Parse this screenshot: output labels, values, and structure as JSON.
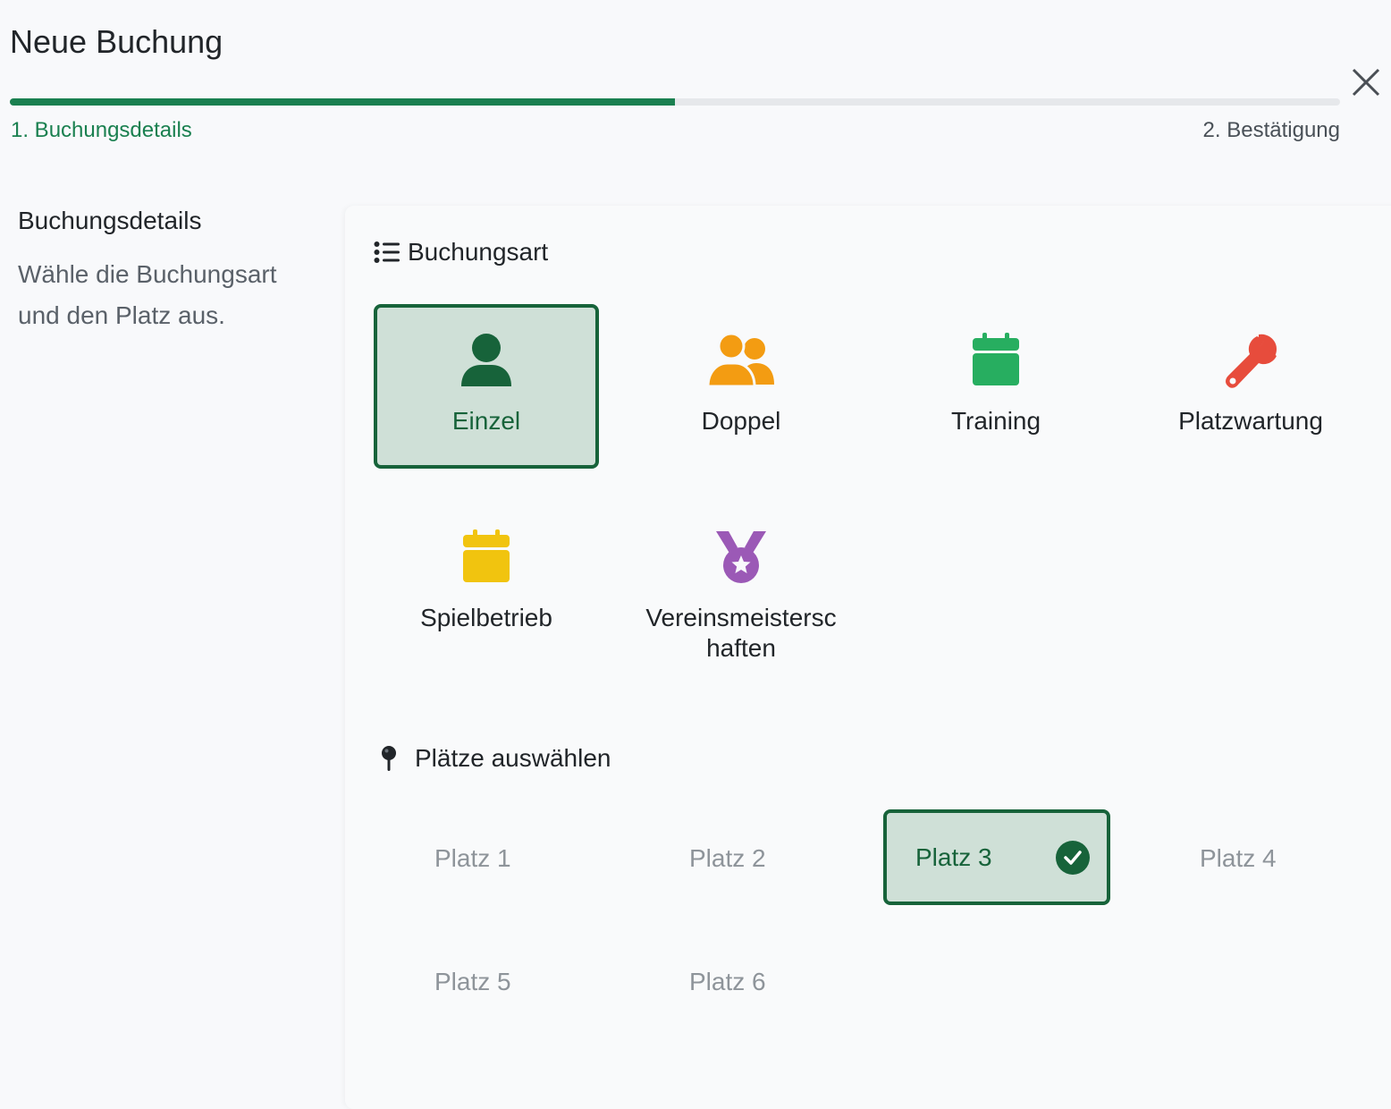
{
  "dialog": {
    "title": "Neue Buchung"
  },
  "progress": {
    "fraction": 0.5,
    "color": "#1a8050"
  },
  "steps": [
    {
      "label": "1. Buchungsdetails",
      "active": true
    },
    {
      "label": "2. Bestätigung",
      "active": false
    }
  ],
  "sidebar": {
    "title": "Buchungsdetails",
    "description": "Wähle die Buchungsart und den Platz aus."
  },
  "booking_type": {
    "heading": "Buchungsart",
    "heading_icon": "list-icon",
    "options": [
      {
        "label": "Einzel",
        "icon": "user-icon",
        "color": "#17633a",
        "selected": true
      },
      {
        "label": "Doppel",
        "icon": "users-icon",
        "color": "#f39c12",
        "selected": false
      },
      {
        "label": "Training",
        "icon": "calendar-icon",
        "color": "#27ae60",
        "selected": false
      },
      {
        "label": "Platzwartung",
        "icon": "wrench-icon",
        "color": "#e74c3c",
        "selected": false
      },
      {
        "label": "Spielbetrieb",
        "icon": "calendar-icon",
        "color": "#f1c40f",
        "selected": false
      },
      {
        "label": "Vereinsmeisterschaften",
        "icon": "medal-icon",
        "color": "#9b59b6",
        "selected": false
      }
    ]
  },
  "courts": {
    "heading": "Plätze auswählen",
    "heading_icon": "map-pin-icon",
    "items": [
      {
        "label": "Platz 1",
        "selected": false
      },
      {
        "label": "Platz 2",
        "selected": false
      },
      {
        "label": "Platz 3",
        "selected": true
      },
      {
        "label": "Platz 4",
        "selected": false
      },
      {
        "label": "Platz 5",
        "selected": false
      },
      {
        "label": "Platz 6",
        "selected": false
      }
    ]
  },
  "colors": {
    "accent": "#1a8050",
    "selected_bg": "#cfe0d7",
    "selected_border": "#17633a"
  }
}
